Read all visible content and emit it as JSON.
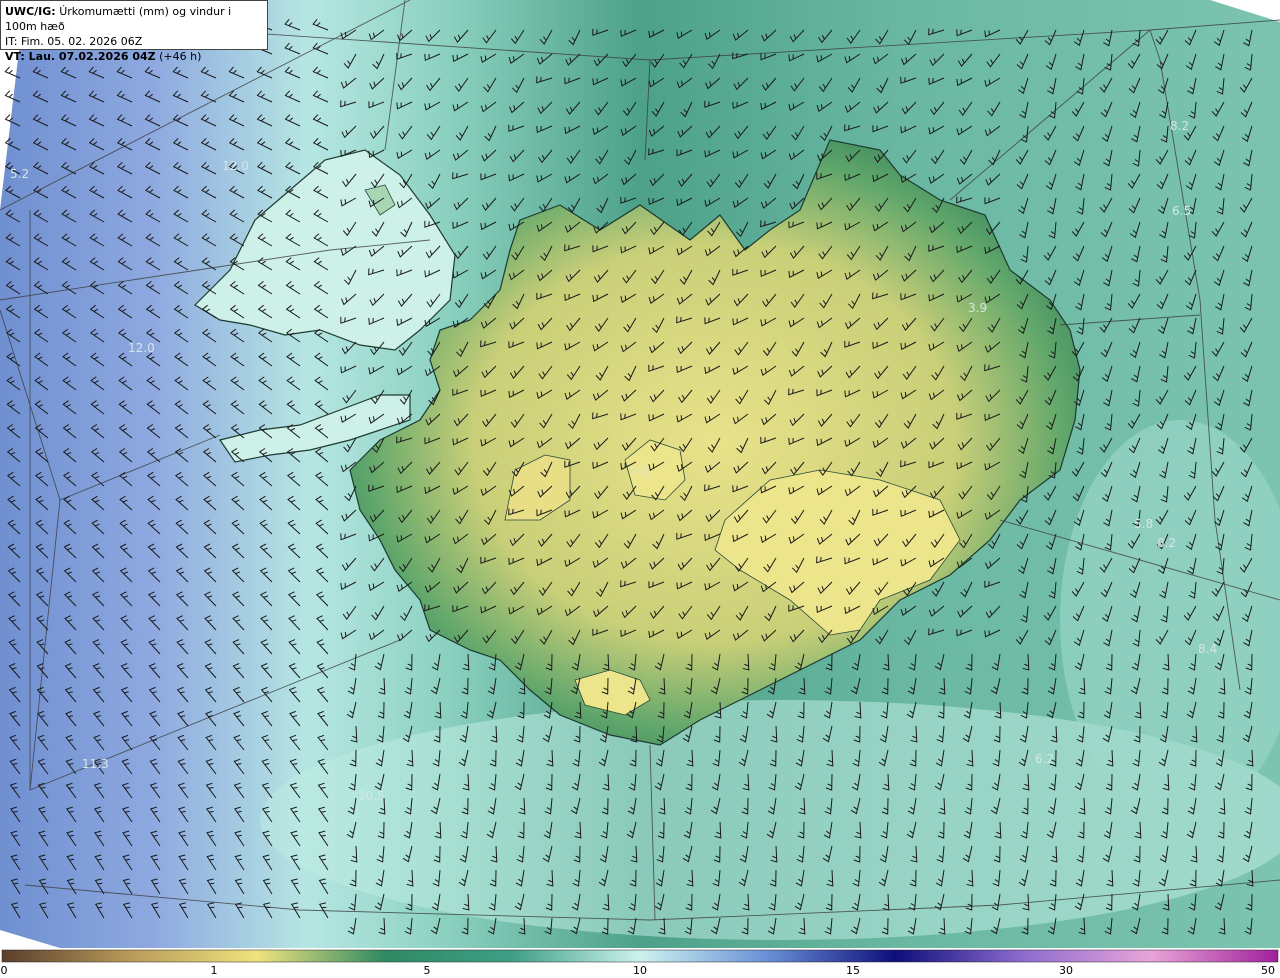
{
  "header": {
    "model": "UWC/IG:",
    "title": "Úrkomumætti (mm) og vindur i 100m hæð",
    "init_time": "IT: Fim. 05. 02. 2026 06Z",
    "valid_time": "VT: Lau. 07.02.2026 04Z",
    "lead": "(+46 h)"
  },
  "map_labels": [
    "5.2",
    "12.0",
    "12.0",
    "8.2",
    "6.5",
    "3.9",
    "5.8",
    "8.2",
    "8.4",
    "6.2",
    "10.5",
    "11.3",
    "7.0"
  ],
  "colorbar": {
    "ticks": [
      "0",
      "1",
      "5",
      "10",
      "15",
      "30",
      "50"
    ],
    "colors": [
      "#5a3e2b",
      "#b89a5a",
      "#efe37e",
      "#2f8a63",
      "#3f9f86",
      "#cdf2ee",
      "#6a8fd6",
      "#0e0e7a",
      "#8d6cd0",
      "#e8a4d8",
      "#a0209a"
    ]
  },
  "colors": {
    "land_yellow": "#e2dc85",
    "land_green": "#2f7d58",
    "sea_teal": "#6ab9a4",
    "sea_light": "#bdebe2",
    "sea_blue": "#7f9cdc"
  }
}
